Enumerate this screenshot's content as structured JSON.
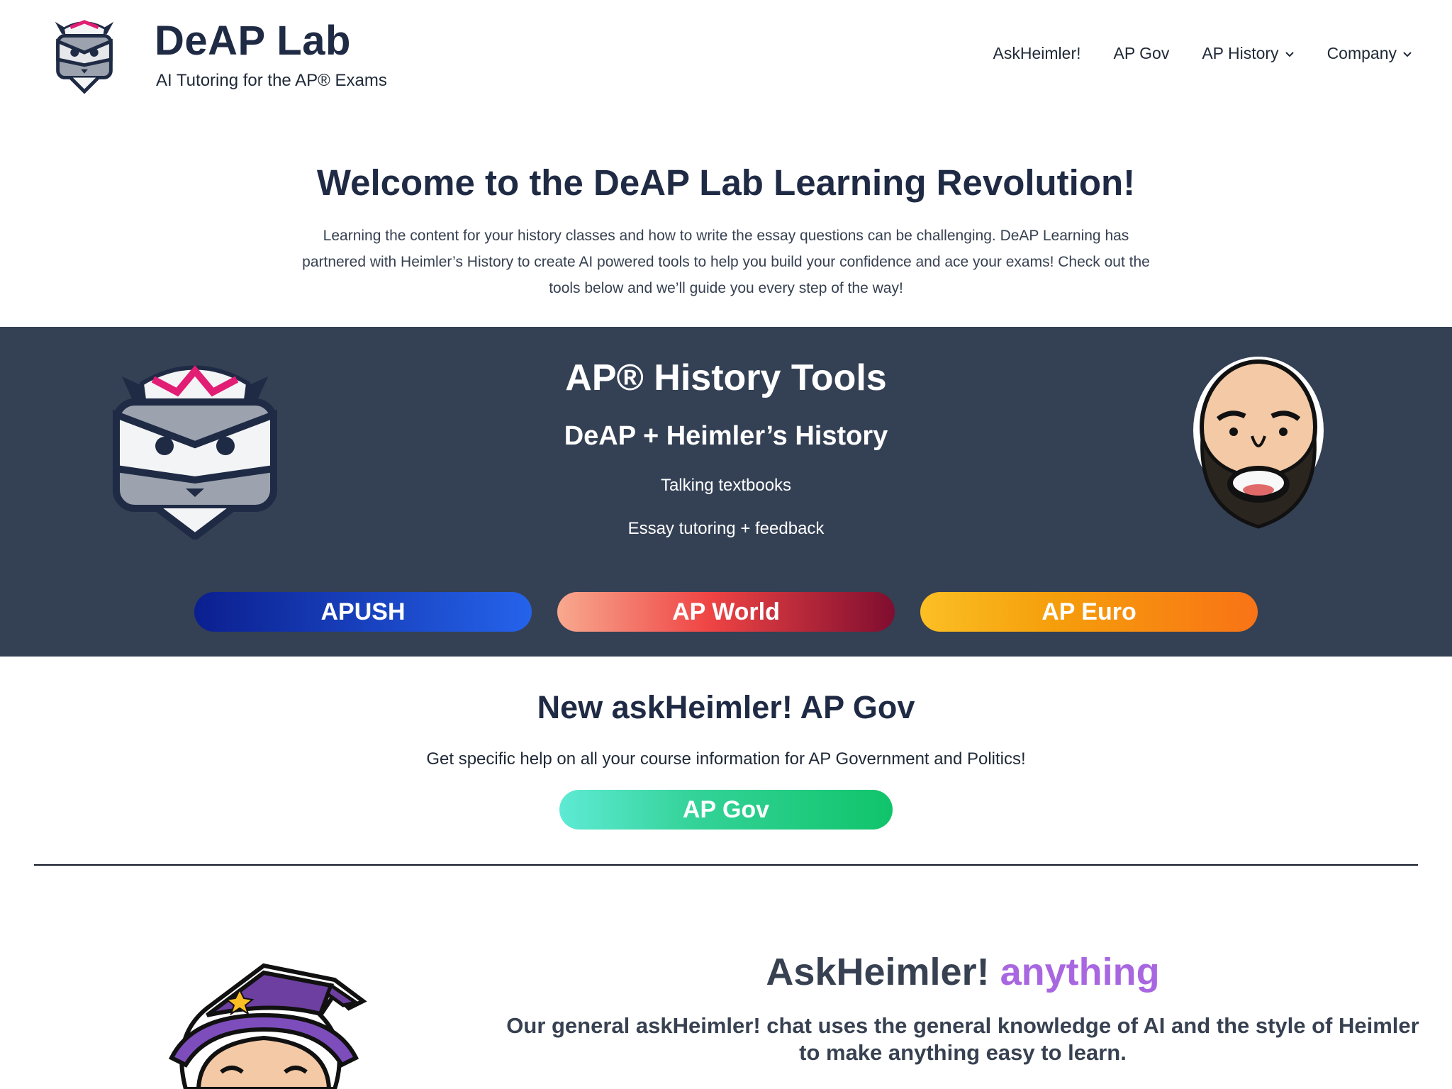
{
  "header": {
    "brand_title": "DeAP Lab",
    "brand_subtitle": "AI Tutoring for the AP® Exams",
    "nav": [
      {
        "label": "AskHeimler!",
        "has_dropdown": false
      },
      {
        "label": "AP Gov",
        "has_dropdown": false
      },
      {
        "label": "AP History",
        "has_dropdown": true
      },
      {
        "label": "Company",
        "has_dropdown": true
      }
    ]
  },
  "intro": {
    "title": "Welcome to the DeAP Lab Learning Revolution!",
    "text": "Learning the content for your history classes and how to write the essay questions can be challenging. DeAP Learning has partnered with Heimler’s History to create AI powered tools to help you build your confidence and ace your exams! Check out the tools below and we’ll guide you every step of the way!"
  },
  "history_tools": {
    "title": "AP® History Tools",
    "subtitle": "DeAP + Heimler’s History",
    "line1": "Talking textbooks",
    "line2": "Essay tutoring + feedback",
    "buttons": [
      {
        "label": "APUSH"
      },
      {
        "label": "AP World"
      },
      {
        "label": "AP Euro"
      }
    ]
  },
  "gov": {
    "title": "New askHeimler! AP Gov",
    "description": "Get specific help on all your course information for AP Government and Politics!",
    "button_label": "AP Gov"
  },
  "ask": {
    "title_main": "AskHeimler!",
    "title_accent": "anything",
    "description": "Our general askHeimler! chat uses the general knowledge of AI and the style of Heimler to make anything easy to learn."
  },
  "colors": {
    "band": "#344054",
    "accent_purple": "#a867e0",
    "apush_gradient": [
      "#0b1f8f",
      "#2563eb"
    ],
    "world_gradient": [
      "#f8a98f",
      "#ef4444",
      "#7f0d2f"
    ],
    "euro_gradient": [
      "#fbbf24",
      "#f97316"
    ],
    "gov_gradient": [
      "#5eead4",
      "#10c46a"
    ]
  },
  "icons": {
    "logo": "owl-book-mascot-icon",
    "chevron": "chevron-down-icon",
    "heimler": "bearded-man-avatar",
    "wizard": "wizard-heimler-avatar"
  }
}
